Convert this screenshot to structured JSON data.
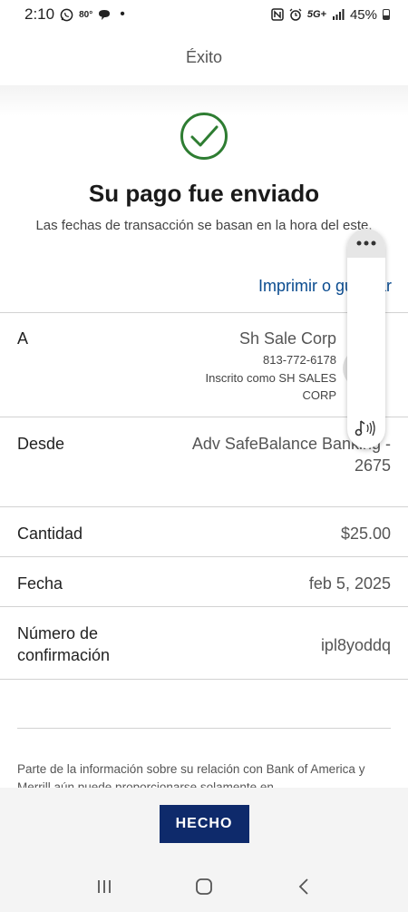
{
  "status_bar": {
    "time": "2:10",
    "temperature": "80°",
    "battery_percent": "45%",
    "network": "5G+",
    "icons": [
      "whatsapp-icon",
      "message-icon",
      "nfc-icon",
      "alarm-icon",
      "signal-icon",
      "battery-icon"
    ]
  },
  "header": {
    "title": "Éxito"
  },
  "success": {
    "title": "Su pago fue enviado",
    "subtitle": "Las fechas de transacción se basan en la hora del este.",
    "print_link": "Imprimir o guardar"
  },
  "details": {
    "to": {
      "label": "A",
      "name": "Sh Sale Corp",
      "phone": "813-772-6178",
      "enrolled_line1": "Inscrito como SH SALES",
      "enrolled_line2": "CORP"
    },
    "from": {
      "label": "Desde",
      "account_line1": "Adv SafeBalance Banking -",
      "account_line2": "2675"
    },
    "amount": {
      "label": "Cantidad",
      "value": "$25.00"
    },
    "date": {
      "label": "Fecha",
      "value": "feb 5, 2025"
    },
    "confirmation": {
      "label_line1": "Número de",
      "label_line2": "confirmación",
      "value": "ipl8yoddq"
    }
  },
  "disclaimer": "Parte de la información sobre su relación con Bank of America y Merrill aún puede proporcionarse solamente en",
  "done_button": "HECHO",
  "colors": {
    "accent": "#0a4b8f",
    "button": "#0e2a6b",
    "check": "#2e7d32"
  }
}
